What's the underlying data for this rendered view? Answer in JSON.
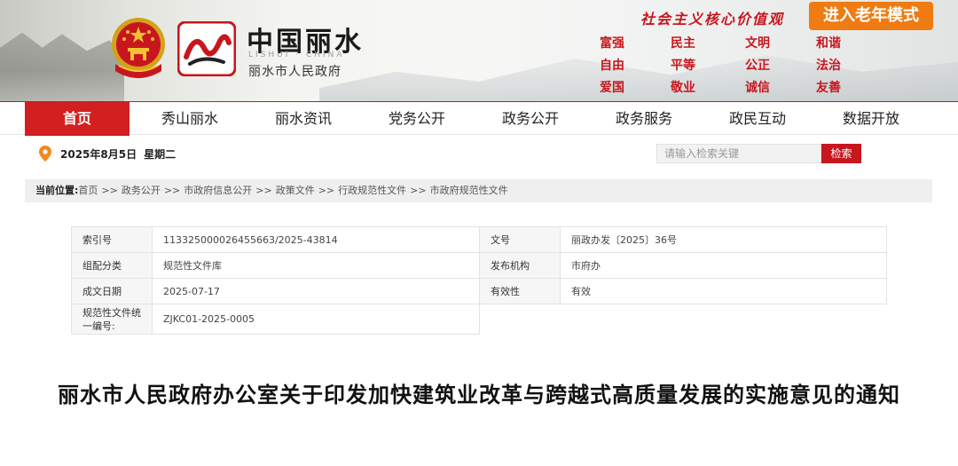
{
  "header": {
    "site_title": "中国丽水",
    "site_subtitle": "LISHUI · CHINA",
    "site_name": "丽水市人民政府",
    "values_slogan": "社会主义核心价值观",
    "elder_mode_label": "进入老年模式",
    "core_values": [
      "富强",
      "民主",
      "文明",
      "和谐",
      "自由",
      "平等",
      "公正",
      "法治",
      "爱国",
      "敬业",
      "诚信",
      "友善"
    ]
  },
  "nav": {
    "items": [
      "首页",
      "秀山丽水",
      "丽水资讯",
      "党务公开",
      "政务公开",
      "政务服务",
      "政民互动",
      "数据开放"
    ],
    "active_index": 0
  },
  "toolbar": {
    "date": "2025年8月5日",
    "weekday": "星期二",
    "search_placeholder": "请输入检索关键",
    "search_button": "检索"
  },
  "breadcrumb": {
    "lead": "当前位置:",
    "items": [
      "首页",
      "政务公开",
      "市政府信息公开",
      "政策文件",
      "行政规范性文件",
      "市政府规范性文件"
    ],
    "separator": ">>"
  },
  "meta": {
    "index_label": "索引号",
    "index_value": "113325000026455663/2025-43814",
    "doc_no_label": "文号",
    "doc_no_value": "丽政办发〔2025〕36号",
    "category_label": "组配分类",
    "category_value": "规范性文件库",
    "issuer_label": "发布机构",
    "issuer_value": "市府办",
    "date_label": "成文日期",
    "date_value": "2025-07-17",
    "validity_label": "有效性",
    "validity_value": "有效",
    "code_label": "规范性文件统一编号:",
    "code_value": "ZJKC01-2025-0005"
  },
  "document": {
    "title": "丽水市人民政府办公室关于印发加快建筑业改革与跨越式高质量发展的实施意见的通知"
  },
  "colors": {
    "brand_red": "#c8161e",
    "nav_active": "#d31f1f",
    "elder_orange": "#ef7b12"
  },
  "icons": [
    "national-emblem-icon",
    "lishui-logo-icon",
    "location-pin-icon"
  ]
}
